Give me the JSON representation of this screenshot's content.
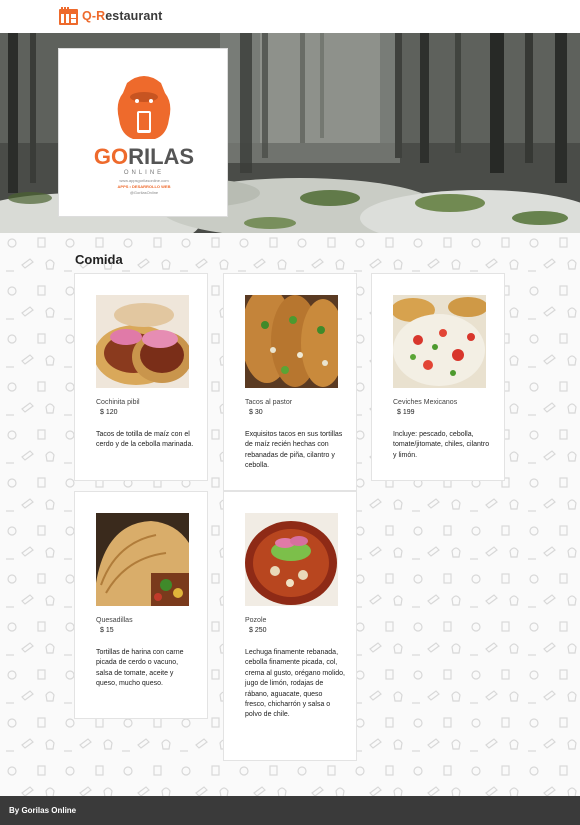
{
  "header": {
    "brand_prefix": "Q-R",
    "brand_suffix": "estaurant",
    "brand_icon": "restaurant-logo-icon"
  },
  "hero": {
    "logo_text_go": "GO",
    "logo_text_rilas": "RILAS",
    "logo_text_online": "ONLINE",
    "logo_line_1": "www.appsgorilasonline.com",
    "logo_line_2": "APPS • DESARROLLO WEB",
    "logo_line_3": "@GorilasOnline"
  },
  "section": {
    "title": "Comida"
  },
  "items": [
    {
      "name": "Cochinita pibil",
      "price": "$ 120",
      "desc": "Tacos de totilla de maíz con el cerdo y de la cebolla marinada."
    },
    {
      "name": "Tacos al pastor",
      "price": "$ 30",
      "desc": "Exquisitos tacos en sus tortillas de maíz recién hechas con rebanadas de piña, cilantro y cebolla."
    },
    {
      "name": "Ceviches Mexicanos",
      "price": "$ 199",
      "desc": "Incluye: pescado, cebolla, tomate/jitomate, chiles, cilantro y limón."
    },
    {
      "name": "Quesadillas",
      "price": "$ 15",
      "desc": "Tortillas de harina con carne picada de cerdo o vacuno, salsa de tomate, aceite y queso, mucho queso."
    },
    {
      "name": "Pozole",
      "price": "$ 250",
      "desc": "Lechuga finamente rebanada, cebolla finamente picada, col, crema al gusto, orégano molido, jugo de limón, rodajas de rábano, aguacate, queso fresco, chicharrón y salsa o polvo de chile."
    }
  ],
  "footer": {
    "text": "By Gorilas Online"
  },
  "colors": {
    "accent": "#ee6a2c",
    "footer_bg": "#3a3a3a",
    "brand_text": "#3a3a3a"
  }
}
